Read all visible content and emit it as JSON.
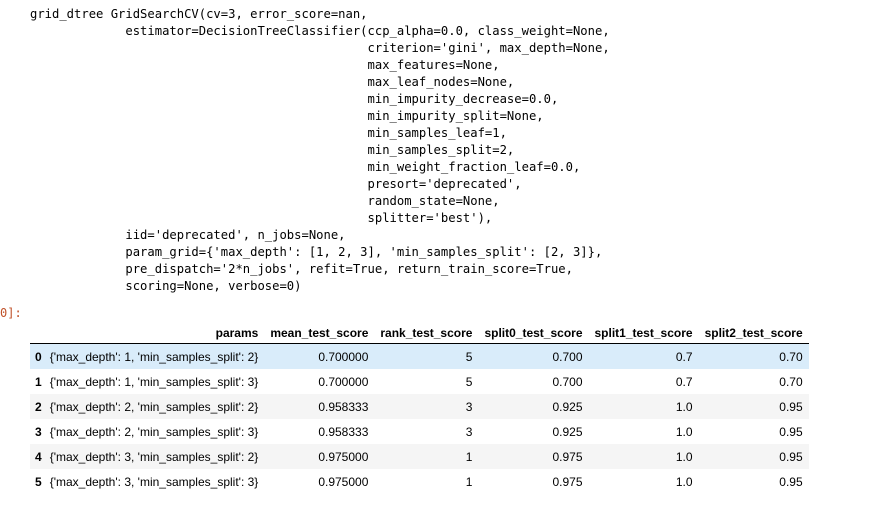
{
  "output_text": "grid_dtree GridSearchCV(cv=3, error_score=nan,\n             estimator=DecisionTreeClassifier(ccp_alpha=0.0, class_weight=None,\n                                              criterion='gini', max_depth=None,\n                                              max_features=None,\n                                              max_leaf_nodes=None,\n                                              min_impurity_decrease=0.0,\n                                              min_impurity_split=None,\n                                              min_samples_leaf=1,\n                                              min_samples_split=2,\n                                              min_weight_fraction_leaf=0.0,\n                                              presort='deprecated',\n                                              random_state=None,\n                                              splitter='best'),\n             iid='deprecated', n_jobs=None,\n             param_grid={'max_depth': [1, 2, 3], 'min_samples_split': [2, 3]},\n             pre_dispatch='2*n_jobs', refit=True, return_train_score=True,\n             scoring=None, verbose=0)",
  "prompt_text": "0]:",
  "table": {
    "index_header": "",
    "columns": [
      "params",
      "mean_test_score",
      "rank_test_score",
      "split0_test_score",
      "split1_test_score",
      "split2_test_score"
    ],
    "rows": [
      {
        "index": "0",
        "cells": [
          "{'max_depth': 1, 'min_samples_split': 2}",
          "0.700000",
          "5",
          "0.700",
          "0.7",
          "0.70"
        ]
      },
      {
        "index": "1",
        "cells": [
          "{'max_depth': 1, 'min_samples_split': 3}",
          "0.700000",
          "5",
          "0.700",
          "0.7",
          "0.70"
        ]
      },
      {
        "index": "2",
        "cells": [
          "{'max_depth': 2, 'min_samples_split': 2}",
          "0.958333",
          "3",
          "0.925",
          "1.0",
          "0.95"
        ]
      },
      {
        "index": "3",
        "cells": [
          "{'max_depth': 2, 'min_samples_split': 3}",
          "0.958333",
          "3",
          "0.925",
          "1.0",
          "0.95"
        ]
      },
      {
        "index": "4",
        "cells": [
          "{'max_depth': 3, 'min_samples_split': 2}",
          "0.975000",
          "1",
          "0.975",
          "1.0",
          "0.95"
        ]
      },
      {
        "index": "5",
        "cells": [
          "{'max_depth': 3, 'min_samples_split': 3}",
          "0.975000",
          "1",
          "0.975",
          "1.0",
          "0.95"
        ]
      }
    ],
    "hovered_row": 0
  },
  "colors": {
    "prompt": "#c0522a",
    "row_hover": "#d9ecfa",
    "row_stripe": "#f5f5f5"
  }
}
